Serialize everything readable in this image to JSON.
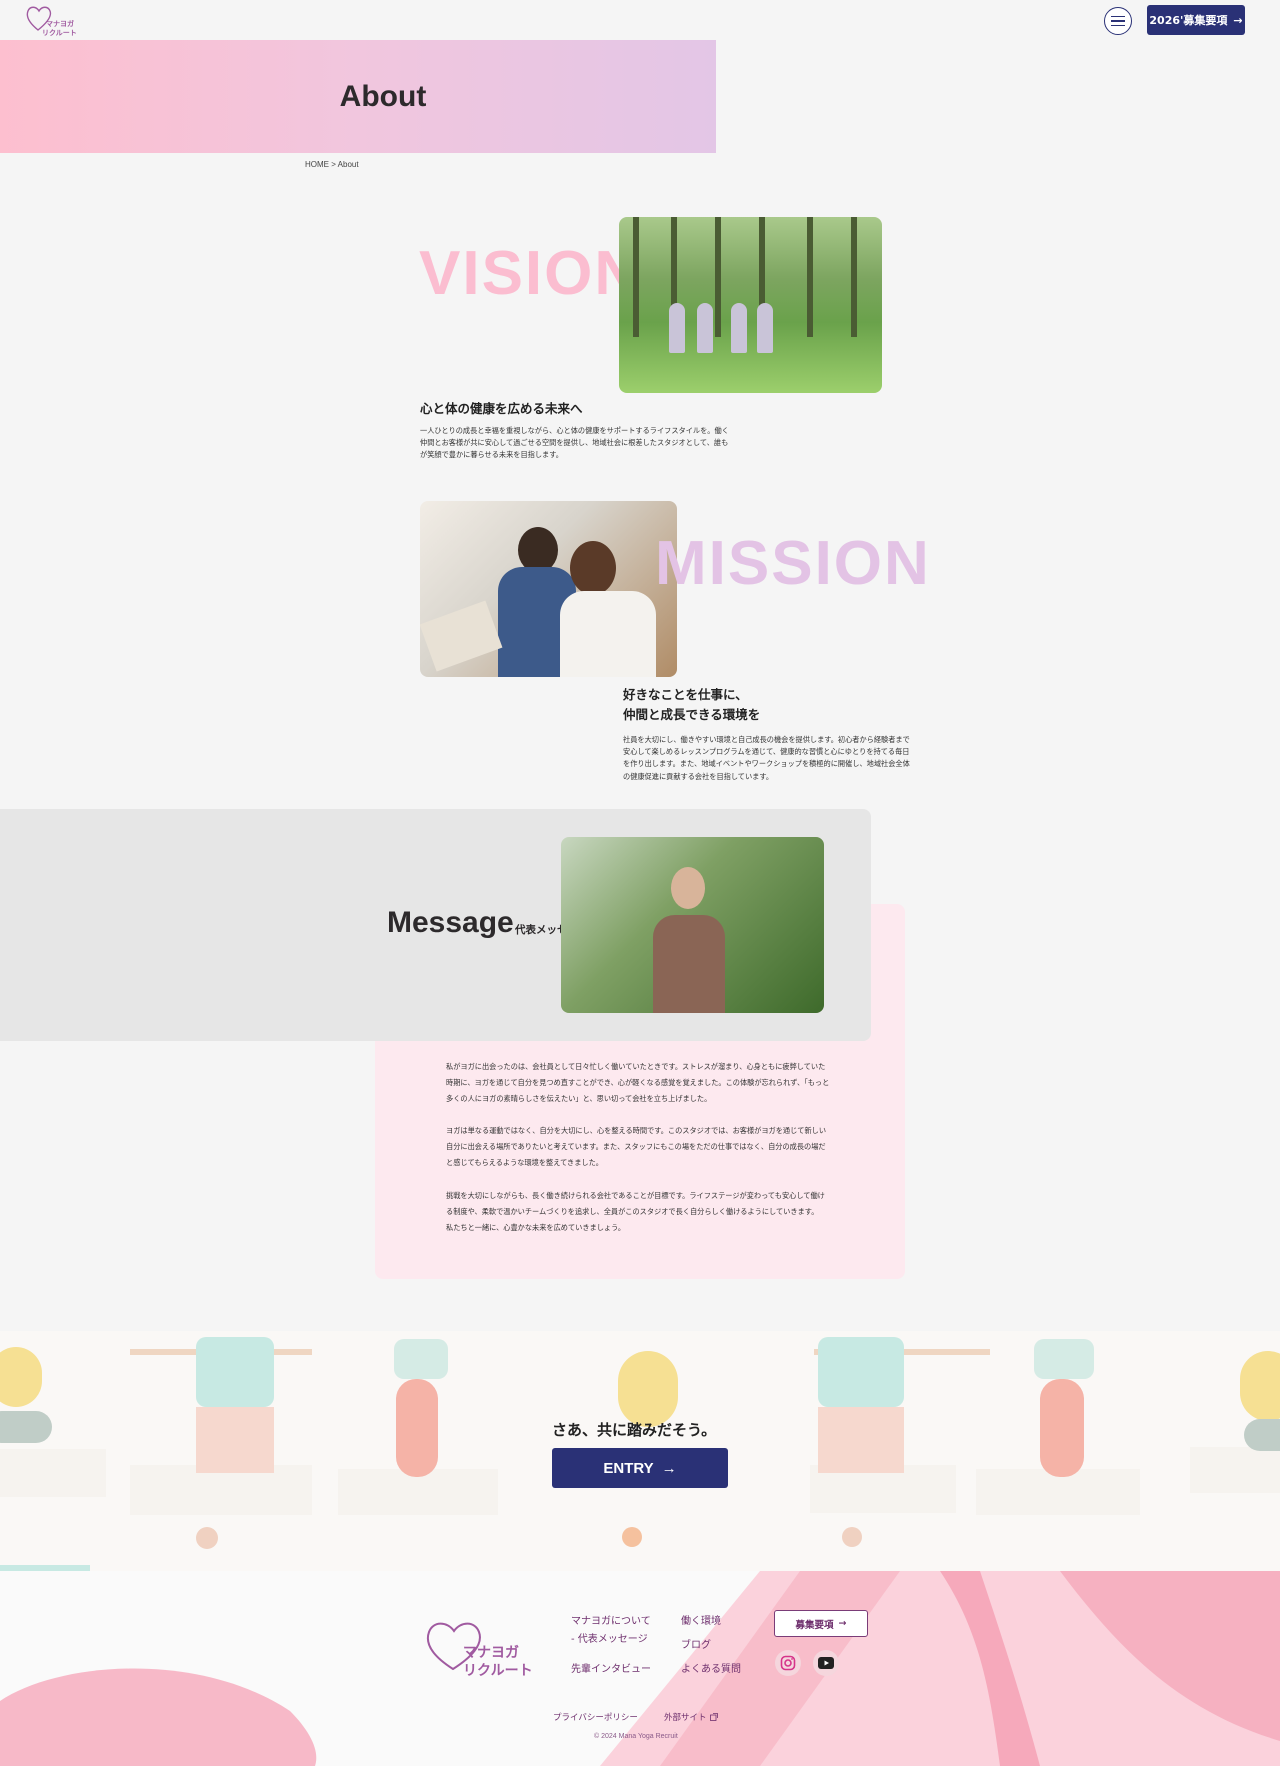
{
  "header": {
    "logo_line1": "マナヨガ",
    "logo_line2": "リクルート",
    "recruit_button": "2026'募集要項",
    "arrow": "→"
  },
  "hero": {
    "title": "About"
  },
  "breadcrumb": "HOME > About",
  "vision": {
    "word": "VISION",
    "heading": "心と体の健康を広める未来へ",
    "body": "一人ひとりの成長と幸福を重視しながら、心と体の健康をサポートするライフスタイルを。働く仲間とお客様が共に安心して過ごせる空間を提供し、地域社会に根差したスタジオとして、誰もが笑顔で豊かに暮らせる未来を目指します。"
  },
  "mission": {
    "word": "MISSION",
    "heading_line1": "好きなことを仕事に、",
    "heading_line2": "仲間と成長できる環境を",
    "body": "社員を大切にし、働きやすい環境と自己成長の機会を提供します。初心者から経験者まで安心して楽しめるレッスンプログラムを通じて、健康的な習慣と心にゆとりを持てる毎日を作り出します。また、地域イベントやワークショップを積極的に開催し、地域社会全体の健康促進に貢献する会社を目指しています。"
  },
  "message": {
    "title": "Message",
    "subtitle": "代表メッセージ",
    "p1": "私がヨガに出会ったのは、会社員として日々忙しく働いていたときです。ストレスが溜まり、心身ともに疲弊していた時期に、ヨガを通じて自分を見つめ直すことができ、心が軽くなる感覚を覚えました。この体験が忘れられず、「もっと多くの人にヨガの素晴らしさを伝えたい」と、思い切って会社を立ち上げました。",
    "p2": "ヨガは単なる運動ではなく、自分を大切にし、心を整える時間です。このスタジオでは、お客様がヨガを通じて新しい自分に出会える場所でありたいと考えています。また、スタッフにもこの場をただの仕事ではなく、自分の成長の場だと感じてもらえるような環境を整えてきました。",
    "p3": "挑戦を大切にしながらも、長く働き続けられる会社であることが目標です。ライフステージが変わっても安心して働ける制度や、柔軟で温かいチームづくりを追求し、全員がこのスタジオで長く自分らしく働けるようにしていきます。",
    "p4": "私たちと一緒に、心豊かな未来を広めていきましょう。"
  },
  "entry": {
    "tagline": "さあ、共に踏みだそう。",
    "button": "ENTRY",
    "arrow": "→"
  },
  "footer": {
    "logo_line1": "マナヨガ",
    "logo_line2": "リクルート",
    "links": {
      "about": "マナヨガについて",
      "message": "- 代表メッセージ",
      "interview": "先輩インタビュー",
      "environment": "働く環境",
      "blog": "ブログ",
      "faq": "よくある質問"
    },
    "recruit_button": "募集要項",
    "arrow": "→",
    "privacy": "プライバシーポリシー",
    "external": "外部サイト",
    "copyright": "© 2024 Mana Yoga Recruit"
  },
  "colors": {
    "navy": "#2a3176",
    "pink": "#fbbdd0",
    "lavender": "#e3c3e5",
    "plum": "#6e2f6d"
  },
  "icons": [
    "heart-logo-icon",
    "hamburger-icon",
    "arrow-right-icon",
    "instagram-icon",
    "youtube-icon",
    "external-link-icon"
  ]
}
